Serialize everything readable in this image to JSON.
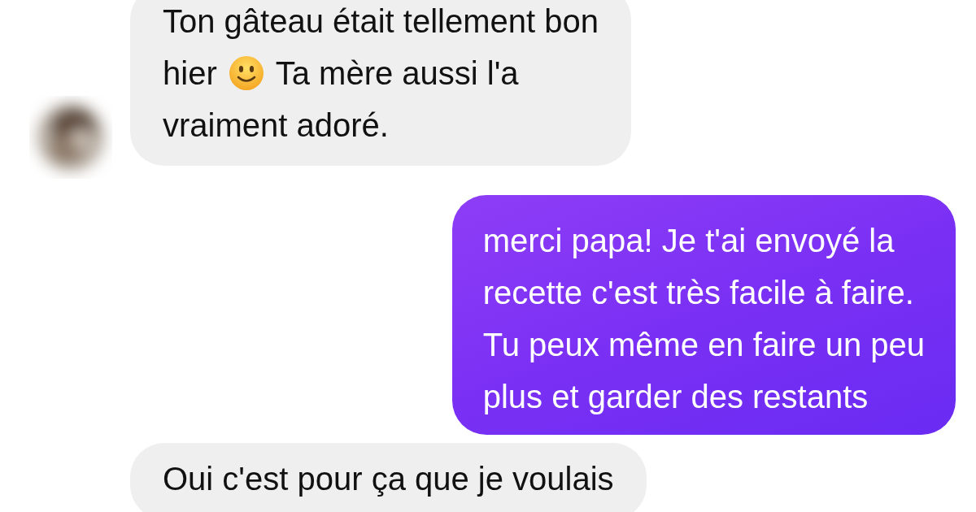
{
  "messages": [
    {
      "kind": "incoming",
      "avatar": {
        "kind": "picture"
      },
      "lines": [
        [
          {
            "kind": "text",
            "text": "Ton gâteau était tellement bon"
          }
        ],
        [
          {
            "kind": "text",
            "text": "hier"
          },
          {
            "kind": "emoji"
          },
          {
            "kind": "text",
            "text": "Ta mère aussi l'a"
          }
        ],
        [
          {
            "kind": "text",
            "text": "vraiment adoré."
          }
        ]
      ]
    },
    {
      "kind": "outgoing",
      "lines": [
        [
          {
            "kind": "text",
            "text": "merci papa! Je t'ai envoyé la"
          }
        ],
        [
          {
            "kind": "text",
            "text": "recette c'est très facile à faire."
          }
        ],
        [
          {
            "kind": "text",
            "text": "Tu peux même en faire un peu"
          }
        ],
        [
          {
            "kind": "text",
            "text": "plus et garder des restants"
          }
        ]
      ]
    },
    {
      "kind": "incoming",
      "lines": [
        [
          {
            "kind": "text",
            "text": "Oui c'est pour ça que je voulais"
          }
        ]
      ]
    }
  ]
}
